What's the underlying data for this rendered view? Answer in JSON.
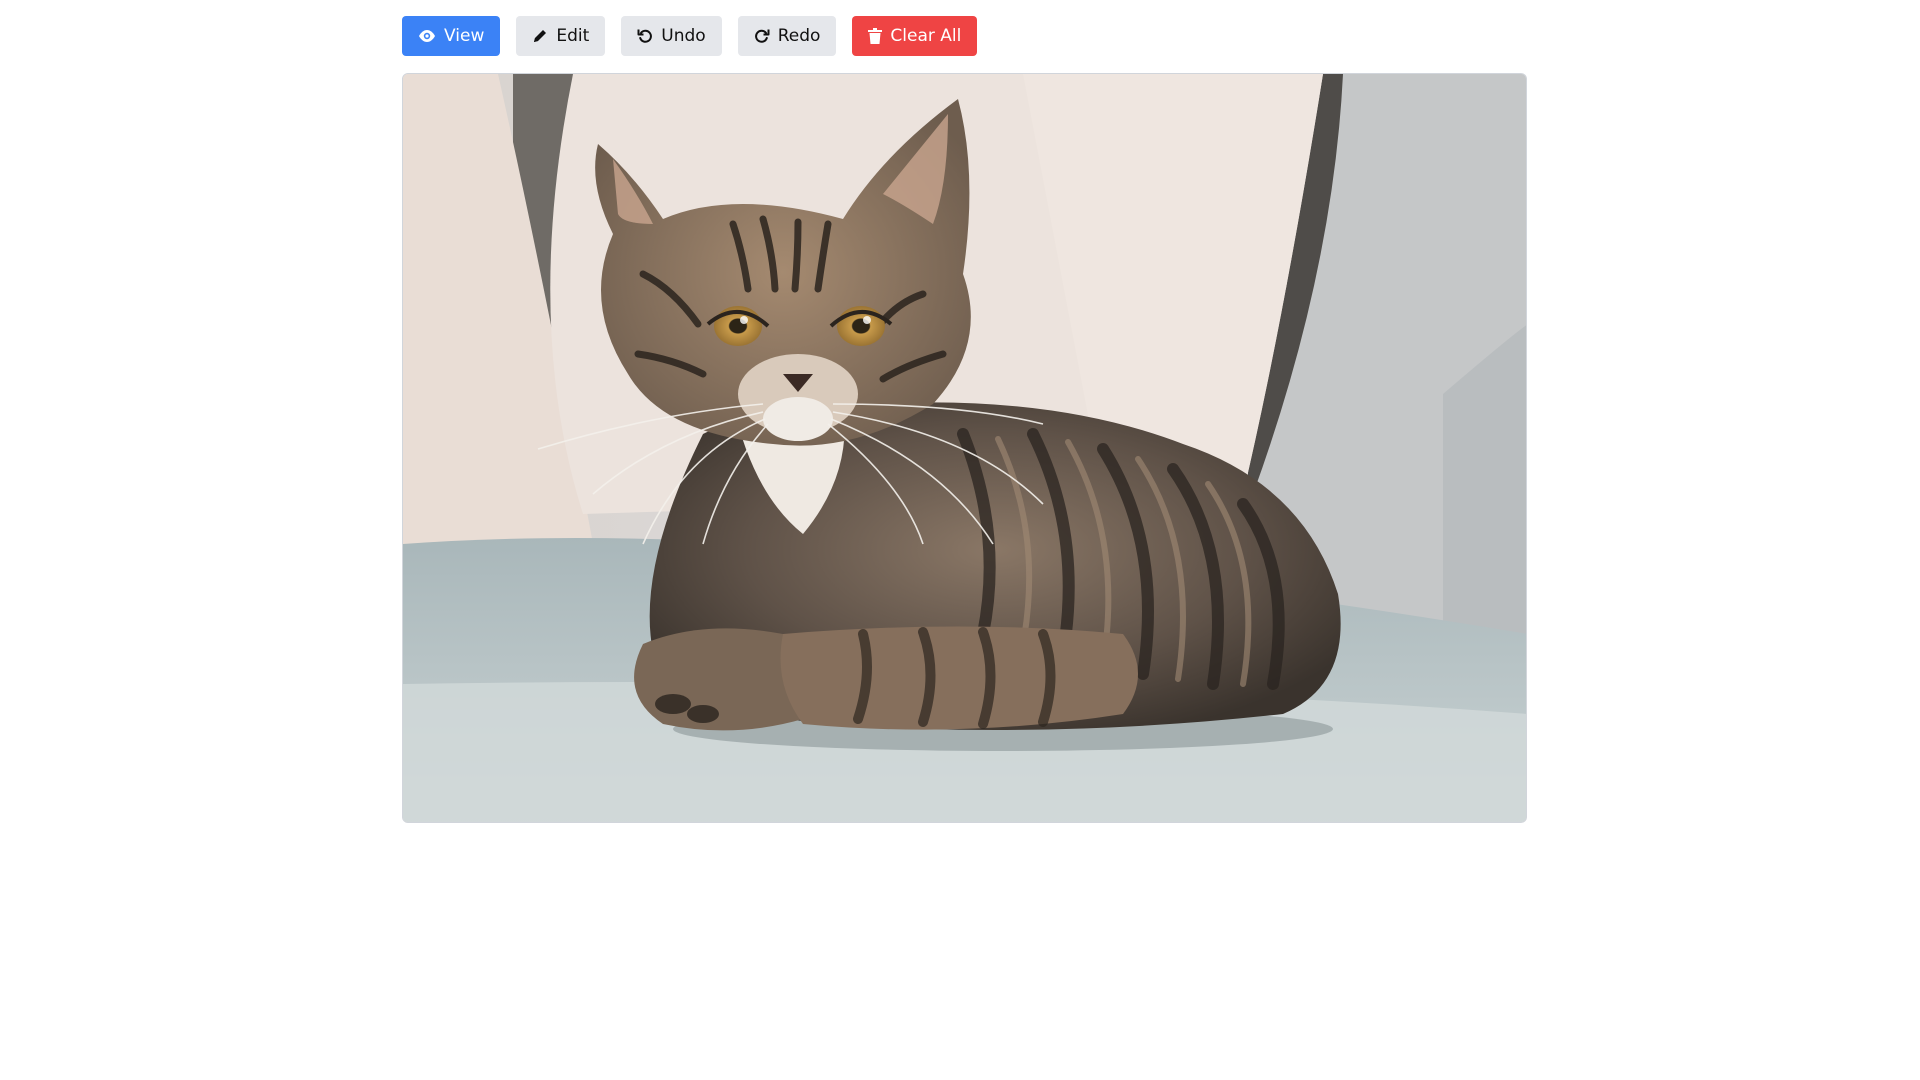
{
  "toolbar": {
    "view": {
      "label": "View",
      "icon": "eye-icon"
    },
    "edit": {
      "label": "Edit",
      "icon": "pencil-icon"
    },
    "undo": {
      "label": "Undo",
      "icon": "undo-icon"
    },
    "redo": {
      "label": "Redo",
      "icon": "redo-icon"
    },
    "clear": {
      "label": "Clear All",
      "icon": "trash-icon"
    }
  },
  "colors": {
    "primary": "#3b82f6",
    "secondary": "#e5e7eb",
    "danger": "#ef4444"
  }
}
